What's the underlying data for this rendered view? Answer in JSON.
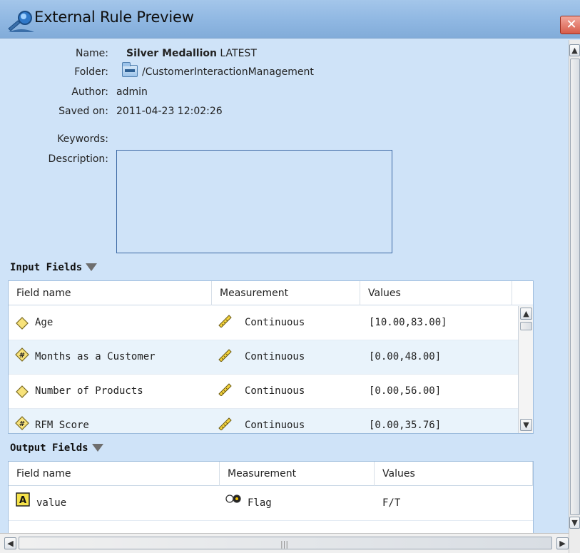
{
  "window": {
    "title": "External Rule Preview",
    "close_glyph": "✕",
    "title_icon": "search-magnifier-icon"
  },
  "info": {
    "name_label": "Name:",
    "name_value": "Silver Medallion",
    "name_version": "LATEST",
    "folder_label": "Folder:",
    "folder_value": "/CustomerInteractionManagement",
    "folder_icon": "folder-icon",
    "author_label": "Author:",
    "author_value": "admin",
    "saved_label": "Saved on:",
    "saved_value": "2011-04-23 12:02:26",
    "keywords_label": "Keywords:",
    "keywords_value": "",
    "description_label": "Description:",
    "description_value": ""
  },
  "input_fields": {
    "title": "Input Fields",
    "columns": [
      "Field name",
      "Measurement",
      "Values"
    ],
    "rows": [
      {
        "icon": "diamond-field-icon",
        "name": "Age",
        "measurement_icon": "ruler-icon",
        "measurement": "Continuous",
        "values": "[10.00,83.00]"
      },
      {
        "icon": "numeric-diamond-icon",
        "name": "Months as a Customer",
        "measurement_icon": "ruler-icon",
        "measurement": "Continuous",
        "values": "[0.00,48.00]"
      },
      {
        "icon": "diamond-field-icon",
        "name": "Number of Products",
        "measurement_icon": "ruler-icon",
        "measurement": "Continuous",
        "values": "[0.00,56.00]"
      },
      {
        "icon": "numeric-diamond-icon",
        "name": "RFM Score",
        "measurement_icon": "ruler-icon",
        "measurement": "Continuous",
        "values": "[0.00,35.76]"
      }
    ]
  },
  "output_fields": {
    "title": "Output Fields",
    "columns": [
      "Field name",
      "Measurement",
      "Values"
    ],
    "rows": [
      {
        "icon": "string-a-icon",
        "name": "value",
        "measurement_icon": "flag-icon",
        "measurement": "Flag",
        "values": "F/T"
      }
    ]
  },
  "colors": {
    "background": "#cfe3f8",
    "titlebar": "#8fb7e2",
    "close": "#d75b49",
    "alt_row": "#e9f3fb"
  }
}
